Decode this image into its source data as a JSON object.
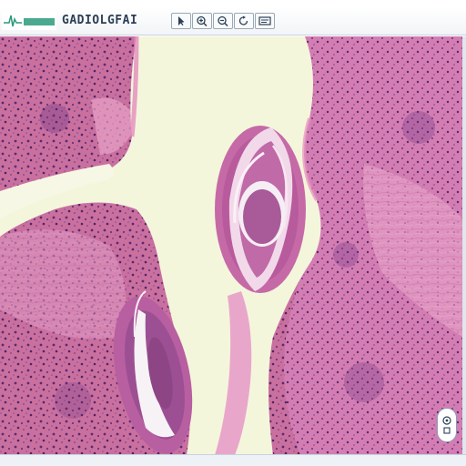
{
  "toolbar": {
    "logo": "slide-viewer-logo",
    "title": "GADIOLGFAI",
    "buttons": [
      {
        "name": "select-tool",
        "icon": "cursor-icon"
      },
      {
        "name": "zoom-in",
        "icon": "zoom-in-icon"
      },
      {
        "name": "zoom-out",
        "icon": "zoom-out-icon"
      },
      {
        "name": "rotate",
        "icon": "rotate-icon"
      },
      {
        "name": "annotate",
        "icon": "annotation-icon"
      }
    ]
  },
  "viewer": {
    "image": "histology-slide-he-stain",
    "navigator_icon": "navigator-icon"
  },
  "colors": {
    "tissue_pink": "#cf78ad",
    "nuclei_purple": "#5b2a72",
    "lumen_cream": "#f4f6dc",
    "toolbar_text": "#2b3f55"
  }
}
